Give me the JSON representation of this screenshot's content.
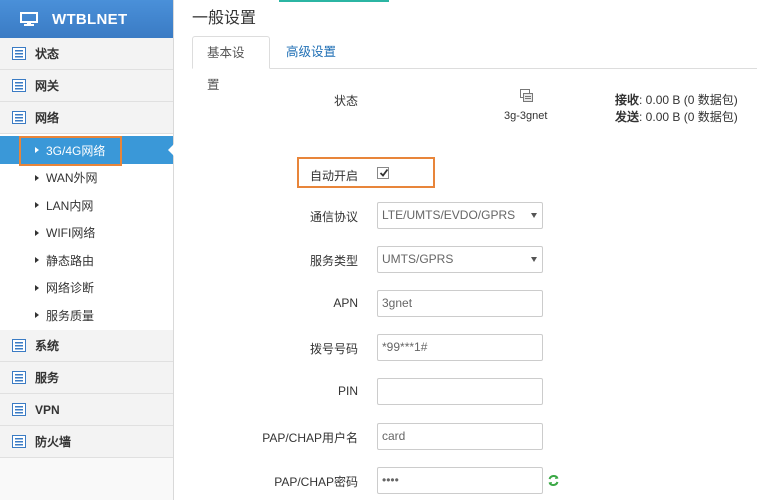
{
  "sidebar": {
    "brand": "WTBLNET",
    "groups_top": [
      {
        "label": "状态"
      },
      {
        "label": "网关"
      },
      {
        "label": "网络"
      }
    ],
    "sub_items": [
      {
        "label": "3G/4G网络"
      },
      {
        "label": "WAN外网"
      },
      {
        "label": "LAN内网"
      },
      {
        "label": "WIFI网络"
      },
      {
        "label": "静态路由"
      },
      {
        "label": "网络诊断"
      },
      {
        "label": "服务质量"
      }
    ],
    "groups_bottom": [
      {
        "label": "系统"
      },
      {
        "label": "服务"
      },
      {
        "label": "VPN"
      },
      {
        "label": "防火墙"
      }
    ]
  },
  "main": {
    "title": "一般设置",
    "tabs": [
      {
        "label": "基本设置"
      },
      {
        "label": "高级设置"
      }
    ],
    "status": {
      "label": "状态",
      "interface": "3g-3gnet",
      "rx_label": "接收",
      "rx_value": ": 0.00 B (0 数据包)",
      "tx_label": "发送",
      "tx_value": ": 0.00 B (0 数据包)"
    },
    "form": {
      "auto_start_label": "自动开启",
      "protocol_label": "通信协议",
      "protocol_value": "LTE/UMTS/EVDO/GPRS",
      "service_label": "服务类型",
      "service_value": "UMTS/GPRS",
      "apn_label": "APN",
      "apn_value": "3gnet",
      "dial_label": "拨号号码",
      "dial_value": "*99***1#",
      "pin_label": "PIN",
      "pin_value": "",
      "user_label": "PAP/CHAP用户名",
      "user_value": "card",
      "pass_label": "PAP/CHAP密码",
      "pass_value": "••••"
    }
  },
  "colors": {
    "header_blue": "#3a7bc4",
    "active_blue": "#3a98d8",
    "highlight_orange": "#e8853a",
    "link_blue": "#1f6fb5",
    "refresh_green": "#3aa845"
  }
}
